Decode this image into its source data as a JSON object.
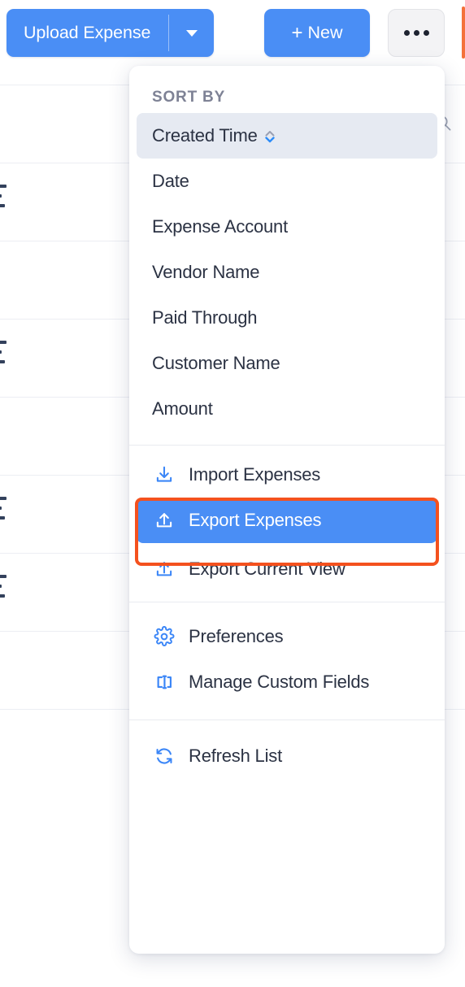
{
  "toolbar": {
    "upload_label": "Upload Expense",
    "upload_caret_icon": "chevron-down-icon",
    "new_label": "+ New",
    "new_plus": "+",
    "new_text": "New",
    "more_icon": "ellipsis-icon"
  },
  "search": {
    "icon": "search-icon"
  },
  "menu": {
    "sort_header": "SORT BY",
    "sort_items": [
      {
        "label": "Created Time",
        "selected": true,
        "sort_icon": "sort-updown-icon",
        "sort_direction": "desc"
      },
      {
        "label": "Date",
        "selected": false
      },
      {
        "label": "Expense Account",
        "selected": false
      },
      {
        "label": "Vendor Name",
        "selected": false
      },
      {
        "label": "Paid Through",
        "selected": false
      },
      {
        "label": "Customer Name",
        "selected": false
      },
      {
        "label": "Amount",
        "selected": false
      }
    ],
    "transfer_actions": [
      {
        "label": "Import Expenses",
        "icon": "download-icon",
        "selected": false
      },
      {
        "label": "Export Expenses",
        "icon": "upload-icon",
        "selected": true,
        "highlighted": true
      },
      {
        "label": "Export Current View",
        "icon": "upload-icon",
        "selected": false
      }
    ],
    "settings_actions": [
      {
        "label": "Preferences",
        "icon": "gear-icon"
      },
      {
        "label": "Manage Custom Fields",
        "icon": "custom-fields-icon"
      }
    ],
    "refresh_actions": [
      {
        "label": "Refresh List",
        "icon": "refresh-icon"
      }
    ]
  },
  "colors": {
    "accent_blue": "#4a8ef5",
    "icon_blue": "#3b86f7",
    "highlight_red": "#f4511e",
    "text_dark": "#2b3243",
    "text_muted": "#7e8295",
    "row_active_bg": "#e6eaf2",
    "edge_marker": "#f4713a"
  }
}
